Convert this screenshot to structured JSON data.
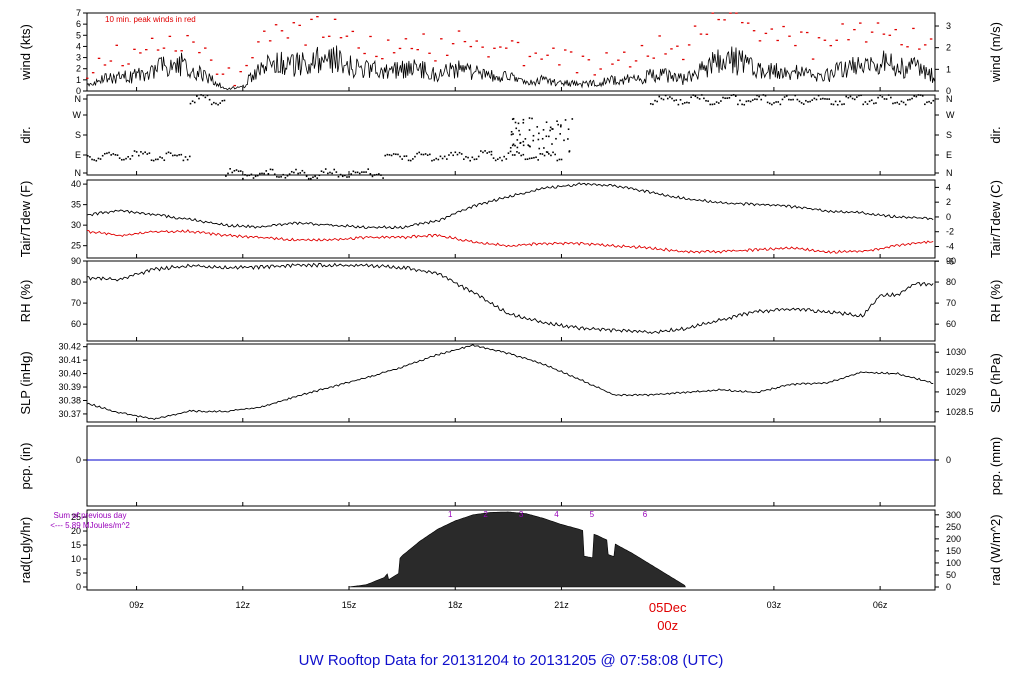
{
  "title": "UW Rooftop Data for 20131204  to  20131205 @ 07:58:08  (UTC)",
  "colors": {
    "title": "#1010cc",
    "red": "#e00000",
    "blue": "#0000cc",
    "purple": "#9900bb",
    "ink": "#000000",
    "fill": "#2a2a2a"
  },
  "time_axis": {
    "ticks": [
      {
        "label": "09z",
        "hour": 9
      },
      {
        "label": "12z",
        "hour": 12
      },
      {
        "label": "15z",
        "hour": 15
      },
      {
        "label": "18z",
        "hour": 18
      },
      {
        "label": "21z",
        "hour": 21
      },
      {
        "label": "03z",
        "hour": 27
      },
      {
        "label": "06z",
        "hour": 30
      }
    ],
    "midnight": {
      "hour": 24,
      "label_top": "05Dec",
      "label_bottom": "00z"
    }
  },
  "panels": {
    "wind": {
      "ylabel_left": "wind (kts)",
      "ylabel_right": "wind (m/s)",
      "note": "10 min. peak winds in red",
      "left_ticks": [
        "0",
        "1",
        "2",
        "3",
        "4",
        "5",
        "6",
        "7"
      ],
      "right_ticks": [
        "0",
        "1",
        "2",
        "3"
      ]
    },
    "dir": {
      "ylabel_left": "dir.",
      "ylabel_right": "dir.",
      "ticks": [
        "N",
        "E",
        "S",
        "W",
        "N"
      ]
    },
    "temp": {
      "ylabel_left": "Tair/Tdew (F)",
      "ylabel_right": "Tair/Tdew (C)",
      "left_ticks": [
        "25",
        "30",
        "35",
        "40"
      ],
      "right_ticks": [
        "-6",
        "-4",
        "-2",
        "0",
        "2",
        "4"
      ]
    },
    "rh": {
      "ylabel_left": "RH (%)",
      "ylabel_right": "RH (%)",
      "left_ticks": [
        "60",
        "70",
        "80",
        "90"
      ],
      "right_ticks": [
        "60",
        "70",
        "80",
        "90"
      ]
    },
    "slp": {
      "ylabel_left": "SLP (inHg)",
      "ylabel_right": "SLP (hPa)",
      "left_ticks": [
        "30.37",
        "30.38",
        "30.39",
        "30.40",
        "30.41",
        "30.42"
      ],
      "right_ticks": [
        "1028.5",
        "1029",
        "1029.5",
        "1030"
      ]
    },
    "pcp": {
      "ylabel_left": "pcp. (in)",
      "ylabel_right": "pcp. (mm)",
      "left_ticks": [
        "0"
      ],
      "right_ticks": [
        "0"
      ]
    },
    "rad": {
      "ylabel_left": "rad(Lgly/hr)",
      "ylabel_right": "rad (W/m^2)",
      "left_ticks": [
        "0",
        "5",
        "10",
        "15",
        "20",
        "25"
      ],
      "right_ticks": [
        "0",
        "50",
        "100",
        "150",
        "200",
        "250",
        "300"
      ],
      "sum_label": "Sum of previous day",
      "sum_value": "<--- 5.89 MJoules/m^2",
      "hour_marks": [
        "1",
        "2",
        "3",
        "4",
        "5",
        "6"
      ]
    }
  },
  "chart_data": [
    {
      "type": "line",
      "title": "wind",
      "ylabel": "wind (kts)",
      "x_units": "hour UTC from 20131204 00z",
      "ylim": [
        0,
        7
      ],
      "series": [
        {
          "x": [
            7.6,
            8,
            9,
            9.5,
            10,
            10.5,
            11,
            11.5,
            12,
            12.5,
            13,
            13.5,
            14,
            14.5,
            15,
            15.5,
            16,
            16.5,
            17,
            17.5,
            18,
            18.5,
            19,
            19.5,
            20,
            20.5,
            21,
            21.5,
            22,
            22.5,
            23,
            23.5,
            24,
            24.5,
            25,
            25.5,
            26,
            26.5,
            27,
            27.5,
            28,
            28.5,
            29,
            29.5,
            30,
            30.5,
            31,
            31.5
          ],
          "y": [
            1,
            1.5,
            2,
            3,
            4,
            3,
            2,
            0.3,
            0.5,
            3.5,
            4,
            3.5,
            4,
            4.5,
            3.5,
            3,
            2.5,
            3,
            3,
            2,
            3,
            2.5,
            2,
            2,
            1,
            1.5,
            1,
            1,
            1,
            1.5,
            1.5,
            2,
            2,
            1.5,
            3,
            4,
            4,
            3,
            3,
            2.5,
            2,
            2,
            3,
            3.5,
            4,
            3,
            3,
            2
          ]
        },
        {
          "name": "10 min. peak winds in red",
          "x": [
            7.6,
            8,
            9,
            9.5,
            10,
            10.5,
            11,
            11.5,
            12,
            12.5,
            13,
            13.5,
            14,
            14.5,
            15,
            15.5,
            16,
            16.5,
            17,
            17.5,
            18,
            18.5,
            19,
            19.5,
            20,
            20.5,
            21,
            21.5,
            22,
            22.5,
            23,
            23.5,
            24,
            24.5,
            25,
            25.5,
            26,
            26.5,
            27,
            27.5,
            28,
            28.5,
            29,
            29.5,
            30,
            30.5,
            31,
            31.5
          ],
          "y": [
            2,
            3,
            3.5,
            4,
            5,
            4,
            3,
            1,
            1.5,
            4.5,
            5,
            5,
            5.5,
            6,
            5,
            4.5,
            4,
            4.5,
            4.5,
            3.5,
            4.5,
            4,
            3.5,
            4,
            3,
            3,
            2.5,
            2.5,
            2.5,
            3,
            3,
            3.5,
            4,
            4,
            6,
            7,
            6.5,
            5,
            5,
            4.5,
            4,
            4,
            5,
            5.5,
            5.5,
            5,
            4.5,
            4
          ]
        }
      ]
    },
    {
      "type": "scatter",
      "title": "dir.",
      "ylabel": "dir.",
      "categories": [
        "N",
        "E",
        "S",
        "W",
        "N"
      ],
      "x_units": "hour UTC from 20131204 00z",
      "segments": [
        {
          "x_start": 7.6,
          "x_end": 10.5,
          "y": "E"
        },
        {
          "x_start": 10.5,
          "x_end": 11.5,
          "y": "N"
        },
        {
          "x_start": 11.5,
          "x_end": 16,
          "y": "N"
        },
        {
          "x_start": 16,
          "x_end": 19,
          "y": "E"
        },
        {
          "x_start": 19,
          "x_end": 21,
          "y": "E"
        },
        {
          "x_start": 23.5,
          "x_end": 26.5,
          "y": "N"
        },
        {
          "x_start": 26.5,
          "x_end": 31.5,
          "y": "N"
        }
      ]
    },
    {
      "type": "line",
      "title": "Tair/Tdew",
      "ylabel": "Tair/Tdew (F)",
      "ylim": [
        22,
        41
      ],
      "x_units": "hour UTC from 20131204 00z",
      "series": [
        {
          "name": "Tair",
          "x": [
            7.6,
            8.5,
            9.5,
            10.5,
            11.5,
            12.5,
            13.5,
            14.5,
            15.5,
            16.5,
            17.5,
            18.5,
            19.5,
            20.5,
            21.5,
            22.5,
            23.5,
            24.5,
            25.5,
            26.5,
            27.5,
            28.5,
            29.5,
            30.5,
            31.5
          ],
          "y": [
            32.5,
            33.5,
            32.5,
            31.5,
            30,
            29.5,
            30.5,
            30,
            29.5,
            29.5,
            31,
            34.5,
            37,
            39,
            40,
            39.5,
            38,
            36.5,
            35.5,
            35,
            34.5,
            33.5,
            33,
            32,
            31.5
          ]
        },
        {
          "name": "Tdew",
          "x": [
            7.6,
            8.5,
            9.5,
            10.5,
            11.5,
            12.5,
            13.5,
            14.5,
            15.5,
            16.5,
            17.5,
            18.5,
            19.5,
            20.5,
            21.5,
            22.5,
            23.5,
            24.5,
            25.5,
            26.5,
            27.5,
            28.5,
            29.5,
            30.5,
            31.5
          ],
          "y": [
            28.5,
            27.5,
            28.5,
            28.5,
            27.5,
            27,
            26.5,
            26.5,
            27,
            27,
            27.5,
            26,
            25,
            25.5,
            25.5,
            25,
            24.5,
            23.5,
            23.5,
            24,
            24.5,
            23.5,
            23.5,
            25,
            26
          ]
        }
      ]
    },
    {
      "type": "line",
      "title": "RH",
      "ylabel": "RH (%)",
      "ylim": [
        52,
        90
      ],
      "x_units": "hour UTC from 20131204 00z",
      "series": [
        {
          "name": "RH",
          "x": [
            7.6,
            8.5,
            9.5,
            10.5,
            11.5,
            12.5,
            13.5,
            14.5,
            15.5,
            16.5,
            17.5,
            18.5,
            19.5,
            20.5,
            21.5,
            22.5,
            23.5,
            24.5,
            25.5,
            26.5,
            27.5,
            28.5,
            29.5,
            30,
            30.5,
            31,
            31.5
          ],
          "y": [
            82,
            81,
            86,
            88,
            87,
            87,
            88,
            88,
            88,
            87,
            84,
            75,
            65,
            61,
            58,
            57,
            56,
            58,
            62,
            66,
            67,
            66,
            64,
            74,
            74,
            79,
            79
          ]
        }
      ]
    },
    {
      "type": "line",
      "title": "SLP",
      "ylabel": "SLP (inHg)",
      "ylim": [
        30.364,
        30.422
      ],
      "x_units": "hour UTC from 20131204 00z",
      "series": [
        {
          "name": "SLP",
          "x": [
            7.6,
            8.5,
            9.5,
            10.5,
            11.5,
            12.5,
            13.5,
            14.5,
            15.5,
            16.5,
            17.5,
            18.5,
            19.5,
            20.5,
            21.5,
            22.5,
            23.5,
            24.5,
            25.5,
            26.5,
            27.5,
            28.5,
            29.5,
            30.5,
            31.5
          ],
          "y": [
            30.378,
            30.371,
            30.366,
            30.372,
            30.372,
            30.375,
            30.383,
            30.39,
            30.397,
            30.405,
            30.414,
            30.421,
            30.415,
            30.407,
            30.396,
            30.384,
            30.384,
            30.386,
            30.388,
            30.386,
            30.392,
            30.393,
            30.401,
            30.4,
            30.393
          ]
        }
      ]
    },
    {
      "type": "line",
      "title": "pcp.",
      "ylabel": "pcp. (in)",
      "x_units": "hour UTC from 20131204 00z",
      "series": [
        {
          "name": "pcp",
          "x": [
            7.6,
            31.5
          ],
          "y": [
            0,
            0
          ]
        }
      ]
    },
    {
      "type": "area",
      "title": "rad",
      "ylabel": "rad (W/m^2)",
      "ylim": [
        0,
        320
      ],
      "x_units": "hour UTC from 20131204 00z",
      "series": [
        {
          "name": "rad",
          "x": [
            15,
            15.5,
            16,
            16.5,
            17,
            17.5,
            18,
            18.5,
            19,
            19.5,
            20,
            20.5,
            21,
            21.5,
            22,
            22.5,
            23,
            23.5,
            24,
            24.5
          ],
          "y": [
            0,
            10,
            40,
            130,
            190,
            240,
            275,
            300,
            310,
            312,
            305,
            285,
            260,
            240,
            215,
            180,
            140,
            95,
            50,
            5
          ]
        }
      ]
    }
  ]
}
